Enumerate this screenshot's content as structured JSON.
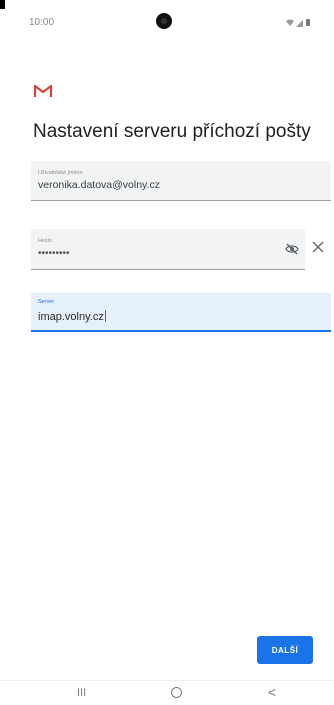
{
  "status_bar": {
    "time": "10:00",
    "icons": [
      "camera-cutout",
      "wifi-icon",
      "signal-icon",
      "battery-icon"
    ]
  },
  "app": {
    "logo": "gmail-icon",
    "brand_color": "#d44638",
    "accent_color": "#1a73e8"
  },
  "title": "Nastavení serveru příchozí pošty",
  "form": {
    "username": {
      "label": "Uživatelské jméno",
      "value": "veronika.datova@volny.cz"
    },
    "password": {
      "label": "Heslo",
      "value": "•••••••••"
    },
    "server": {
      "label": "Server",
      "value": "imap.volny.cz"
    }
  },
  "actions": {
    "next_label": "DALŠÍ"
  },
  "nav_bar": {
    "recent_glyph": "III",
    "back_glyph": "<"
  }
}
